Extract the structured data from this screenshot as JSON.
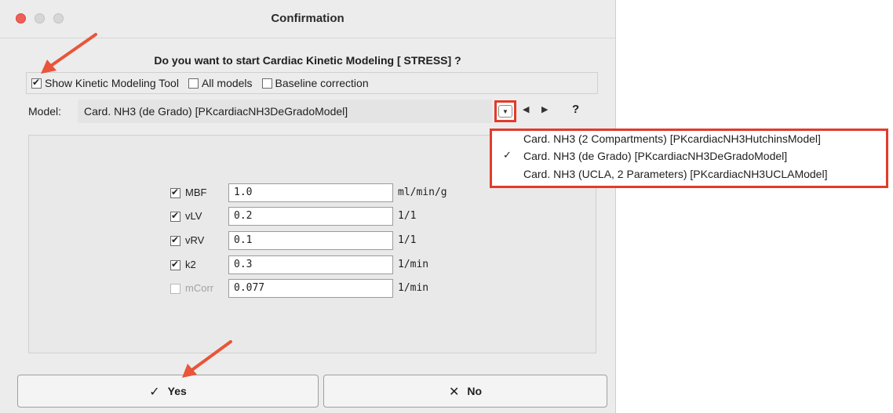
{
  "window": {
    "title": "Confirmation",
    "question": "Do you want to start Cardiac Kinetic Modeling [ STRESS] ?"
  },
  "options": [
    {
      "label": "Show Kinetic Modeling Tool",
      "checked": true
    },
    {
      "label": "All models",
      "checked": false
    },
    {
      "label": "Baseline correction",
      "checked": false
    }
  ],
  "model": {
    "label": "Model:",
    "selected": "Card. NH3 (de Grado) [PKcardiacNH3DeGradoModel]",
    "help_label": "?",
    "dropdown_icon": "chevron-down-icon",
    "prev_icon": "triangle-left-icon",
    "next_icon": "triangle-right-icon"
  },
  "dropdown_options": [
    {
      "label": "Card. NH3 (2 Compartments) [PKcardiacNH3HutchinsModel]",
      "selected": false
    },
    {
      "label": "Card. NH3 (de Grado) [PKcardiacNH3DeGradoModel]",
      "selected": true,
      "check": "✓"
    },
    {
      "label": "Card. NH3 (UCLA, 2 Parameters) [PKcardiacNH3UCLAModel]",
      "selected": false
    }
  ],
  "parameters": [
    {
      "name": "MBF",
      "value": "1.0",
      "unit": "ml/min/g",
      "checked": true,
      "enabled": true
    },
    {
      "name": "vLV",
      "value": "0.2",
      "unit": "1/1",
      "checked": true,
      "enabled": true
    },
    {
      "name": "vRV",
      "value": "0.1",
      "unit": "1/1",
      "checked": true,
      "enabled": true
    },
    {
      "name": "k2",
      "value": "0.3",
      "unit": "1/min",
      "checked": true,
      "enabled": true
    },
    {
      "name": "mCorr",
      "value": "0.077",
      "unit": "1/min",
      "checked": false,
      "enabled": false
    }
  ],
  "buttons": {
    "yes_label": "Yes",
    "yes_icon": "checkmark-icon",
    "no_label": "No",
    "no_icon": "x-icon"
  },
  "colors": {
    "highlight": "#e23b2a",
    "annotation_arrow": "#e8553a"
  }
}
